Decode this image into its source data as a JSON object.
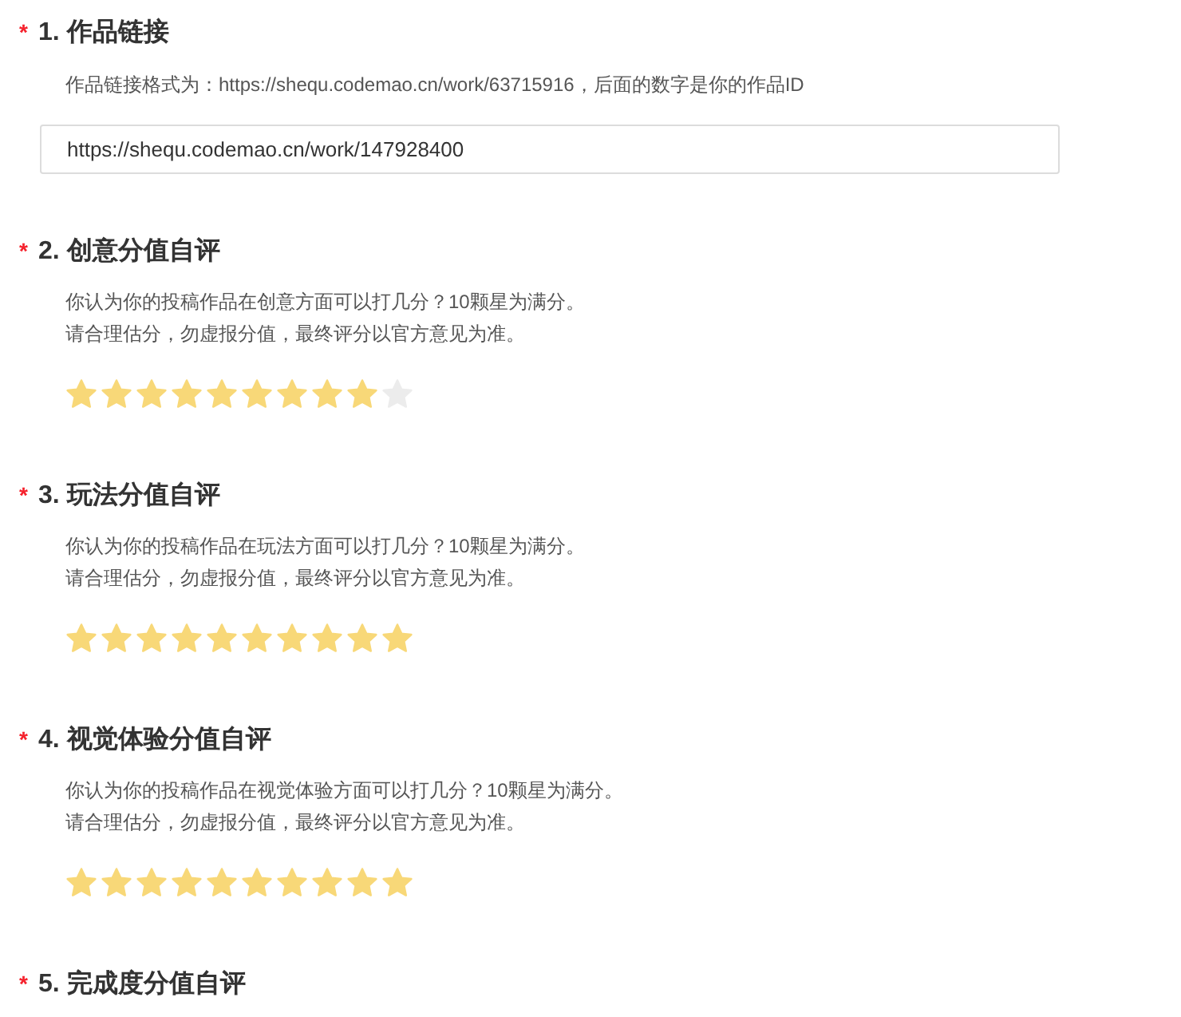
{
  "sections": [
    {
      "kind": "link",
      "mark": "*",
      "title": "1. 作品链接",
      "description": [
        "作品链接格式为：https://shequ.codemao.cn/work/63715916，后面的数字是你的作品ID"
      ],
      "input": {
        "value": "https://shequ.codemao.cn/work/147928400"
      }
    },
    {
      "kind": "rating",
      "mark": "*",
      "title": "2. 创意分值自评",
      "description": [
        "你认为你的投稿作品在创意方面可以打几分？10颗星为满分。",
        "请合理估分，勿虚报分值，最终评分以官方意见为准。"
      ],
      "stars": 9
    },
    {
      "kind": "rating",
      "mark": "*",
      "title": "3. 玩法分值自评",
      "description": [
        "你认为你的投稿作品在玩法方面可以打几分？10颗星为满分。",
        "请合理估分，勿虚报分值，最终评分以官方意见为准。"
      ],
      "stars": 10
    },
    {
      "kind": "rating",
      "mark": "*",
      "title": "4. 视觉体验分值自评",
      "description": [
        "你认为你的投稿作品在视觉体验方面可以打几分？10颗星为满分。",
        "请合理估分，勿虚报分值，最终评分以官方意见为准。"
      ],
      "stars": 10
    },
    {
      "kind": "heading",
      "mark": "*",
      "title": "5. 完成度分值自评"
    }
  ]
}
